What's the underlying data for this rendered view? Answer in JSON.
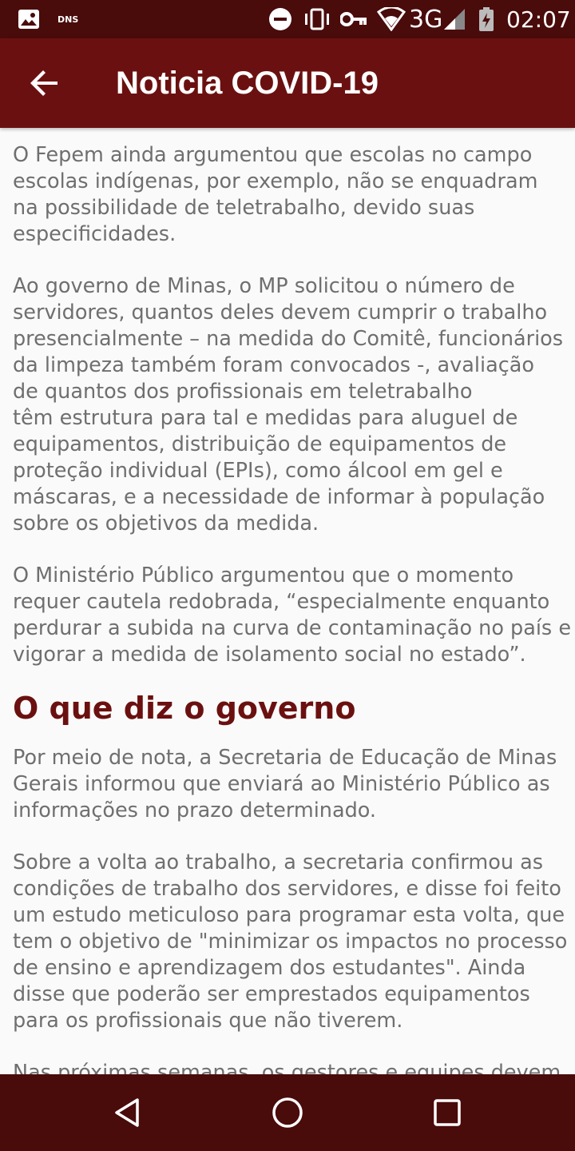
{
  "status_bar": {
    "dns_label": "DNS",
    "network": "3G",
    "time": "02:07",
    "icons": [
      "image-icon",
      "dnd-icon",
      "vibrate-icon",
      "vpn-key-icon",
      "wifi-icon",
      "signal-icon",
      "battery-charging-icon"
    ]
  },
  "app_bar": {
    "title": "Noticia COVID-19",
    "back_icon": "arrow-back-icon"
  },
  "article": {
    "p1": [
      "O Fepem ainda argumentou que escolas no campo",
      "escolas indígenas, por exemplo, não se enquadram",
      "na possibilidade de teletrabalho, devido suas",
      "especificidades."
    ],
    "p2": [
      "Ao governo de Minas, o MP solicitou o número de",
      "servidores, quantos deles devem cumprir o trabalho",
      "presencialmente – na medida do Comitê, funcionários",
      "da limpeza também foram convocados -, avaliação",
      "de quantos dos profissionais em teletrabalho",
      "têm estrutura para tal e medidas para aluguel de",
      "equipamentos, distribuição de equipamentos de",
      "proteção individual (EPIs), como álcool em gel e",
      "máscaras, e a necessidade de informar à população",
      "sobre os objetivos da medida."
    ],
    "p3": [
      "O Ministério Público argumentou que o momento",
      "requer cautela redobrada, “especialmente enquanto",
      "perdurar a subida na curva de contaminação no país e",
      "vigorar a medida de isolamento social no estado”."
    ],
    "heading": "O que diz o governo",
    "p4": [
      "Por meio de nota, a Secretaria de Educação de Minas",
      "Gerais informou que enviará ao Ministério Público as",
      "informações no prazo determinado."
    ],
    "p5": [
      "Sobre a volta ao trabalho, a secretaria confirmou as",
      "condições de trabalho dos servidores, e disse foi feito",
      "um estudo meticuloso para programar esta volta, que",
      "tem o objetivo de \"minimizar os impactos no processo",
      "de ensino e aprendizagem dos estudantes\". Ainda",
      "disse que poderão ser emprestados equipamentos",
      "para os profissionais que não tiverem."
    ],
    "p6": [
      "Nas próximas semanas, os gestores e equipes devem"
    ]
  },
  "nav_bar": {
    "buttons": [
      "back-triangle-icon",
      "home-circle-icon",
      "recents-square-icon"
    ]
  },
  "colors": {
    "status_bar": "#4a0b0b",
    "app_bar": "#6b1010",
    "heading": "#6b1010",
    "body_text": "#6f6f6f",
    "background": "#fafafa"
  }
}
